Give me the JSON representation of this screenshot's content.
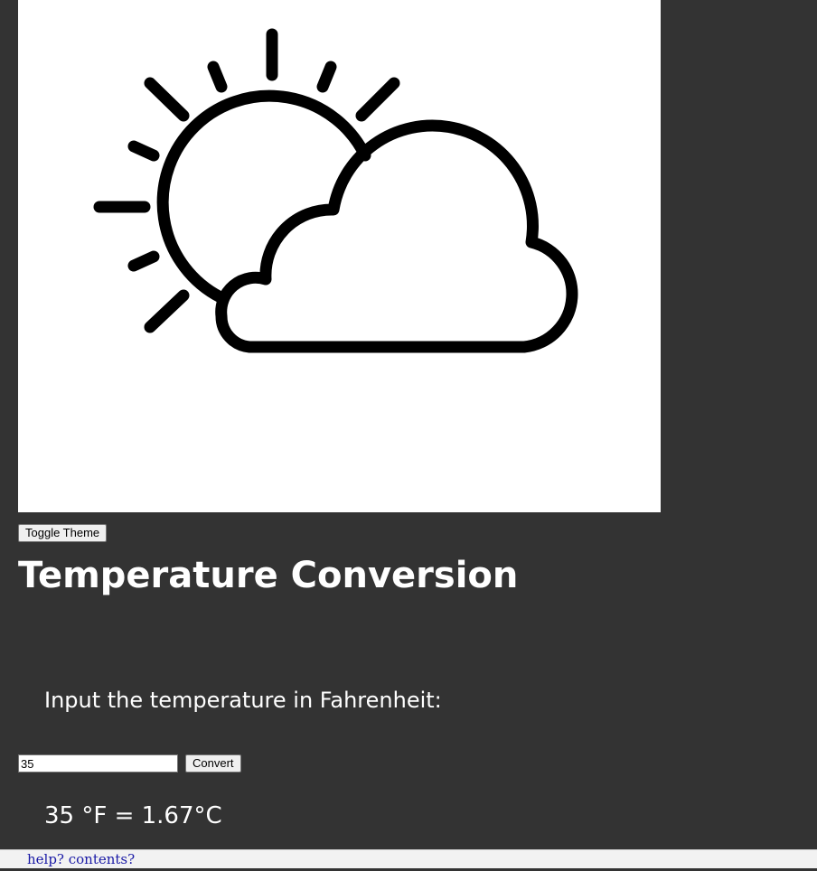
{
  "hero": {
    "icon": "sun-behind-cloud-icon"
  },
  "controls": {
    "toggle_theme_label": "Toggle Theme",
    "convert_label": "Convert"
  },
  "main": {
    "title": "Temperature Conversion",
    "prompt": "Input the temperature in Fahrenheit:",
    "input_value": "35",
    "result": "35 °F = 1.67°C"
  },
  "footer": {
    "help_link": "help? contents?"
  },
  "colors": {
    "background": "#333333",
    "hero_background": "#ffffff",
    "text": "#ffffff",
    "link": "#1a1aa6"
  }
}
